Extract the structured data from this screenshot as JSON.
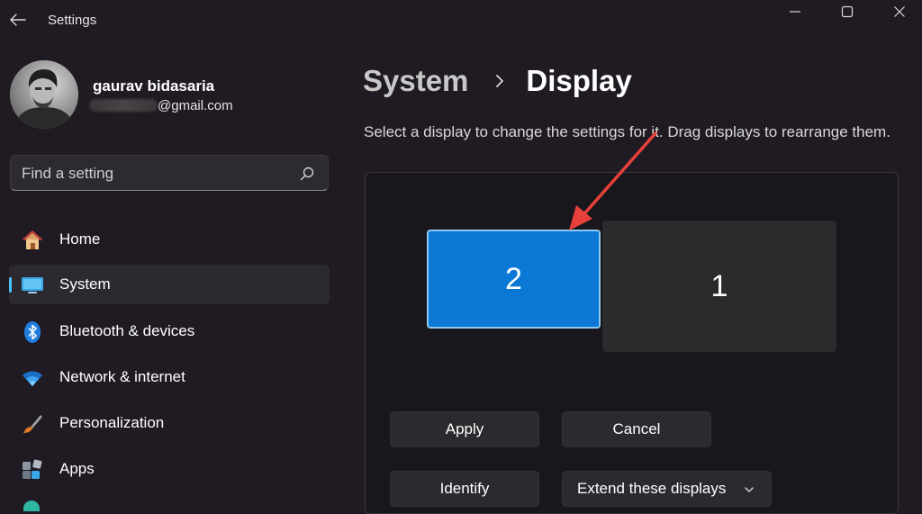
{
  "window": {
    "app_title": "Settings",
    "back_icon": "arrow-left-icon",
    "controls": [
      "minimize-icon",
      "maximize-icon",
      "close-icon"
    ]
  },
  "profile": {
    "name": "gaurav bidasaria",
    "email_visible": "@gmail.com"
  },
  "search": {
    "placeholder": "Find a setting",
    "icon": "search-icon"
  },
  "sidebar": {
    "items": [
      {
        "label": "Home",
        "icon": "home-icon",
        "active": false
      },
      {
        "label": "System",
        "icon": "system-monitor-icon",
        "active": true
      },
      {
        "label": "Bluetooth & devices",
        "icon": "bluetooth-icon",
        "active": false
      },
      {
        "label": "Network & internet",
        "icon": "wifi-icon",
        "active": false
      },
      {
        "label": "Personalization",
        "icon": "paintbrush-icon",
        "active": false
      },
      {
        "label": "Apps",
        "icon": "apps-icon",
        "active": false
      }
    ]
  },
  "main": {
    "breadcrumb": {
      "parent": "System",
      "current": "Display"
    },
    "description": "Select a display to change the settings for it. Drag displays to rearrange them.",
    "displays": [
      {
        "number": "2",
        "selected": true
      },
      {
        "number": "1",
        "selected": false
      }
    ],
    "buttons": {
      "apply": "Apply",
      "cancel": "Cancel",
      "identify": "Identify"
    },
    "mode_dropdown": {
      "value": "Extend these displays",
      "icon": "chevron-down-icon"
    }
  },
  "colors": {
    "accent": "#0a78d4",
    "indicator": "#4cc2ff",
    "annotation_arrow": "#e8413c",
    "background": "#201b22"
  }
}
